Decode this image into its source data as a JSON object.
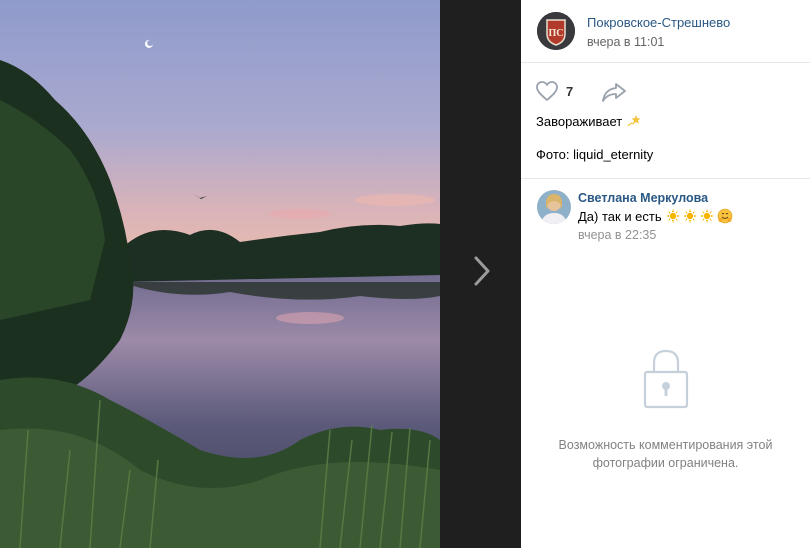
{
  "post": {
    "author_name": "Покровское-Стрешнево",
    "author_logo_text": "ПС",
    "time": "вчера в 11:01",
    "likes": "7",
    "description_line1": "Завораживает",
    "description_emoji": "dizzy-star",
    "description_line2": "Фото: liquid_eternity"
  },
  "comments": [
    {
      "author": "Светлана Меркулова",
      "text": "Да) так и есть",
      "emojis": [
        "sun",
        "sun",
        "sun",
        "hugging-face"
      ],
      "time": "вчера в 22:35"
    }
  ],
  "restriction": {
    "message_line1": "Возможность комментирования этой",
    "message_line2": "фотографии ограничена."
  },
  "colors": {
    "link": "#2a5885",
    "viewer_bg": "#1f1f1f",
    "muted": "#828282"
  }
}
